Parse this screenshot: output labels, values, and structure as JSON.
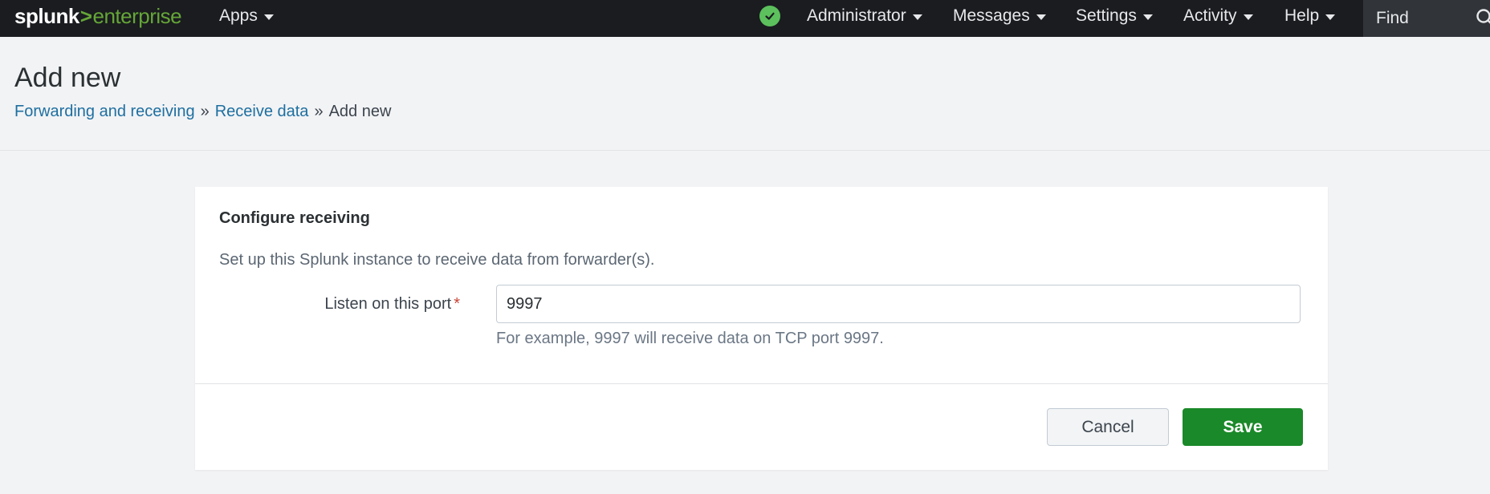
{
  "topbar": {
    "logo": {
      "brand": "splunk",
      "separator": ">",
      "product": "enterprise"
    },
    "apps_label": "Apps",
    "status_icon": "check-circle-icon",
    "administrator_label": "Administrator",
    "messages_label": "Messages",
    "settings_label": "Settings",
    "activity_label": "Activity",
    "help_label": "Help",
    "find_placeholder": "Find",
    "search_icon": "search-icon"
  },
  "header": {
    "title": "Add new",
    "breadcrumb": [
      {
        "label": "Forwarding and receiving"
      },
      {
        "label": "Receive data"
      },
      {
        "label": "Add new"
      }
    ],
    "separator": "»"
  },
  "form": {
    "title": "Configure receiving",
    "description": "Set up this Splunk instance to receive data from forwarder(s).",
    "port_label": "Listen on this port",
    "required_marker": "*",
    "port_value": "9997",
    "help_text": "For example, 9997 will receive data on TCP port 9997.",
    "cancel_label": "Cancel",
    "save_label": "Save"
  },
  "colors": {
    "topbar_bg": "#1a1c20",
    "brand_green": "#65a637",
    "link_blue": "#1e6fa0",
    "save_green": "#1a8929",
    "status_green": "#5cc05c"
  }
}
